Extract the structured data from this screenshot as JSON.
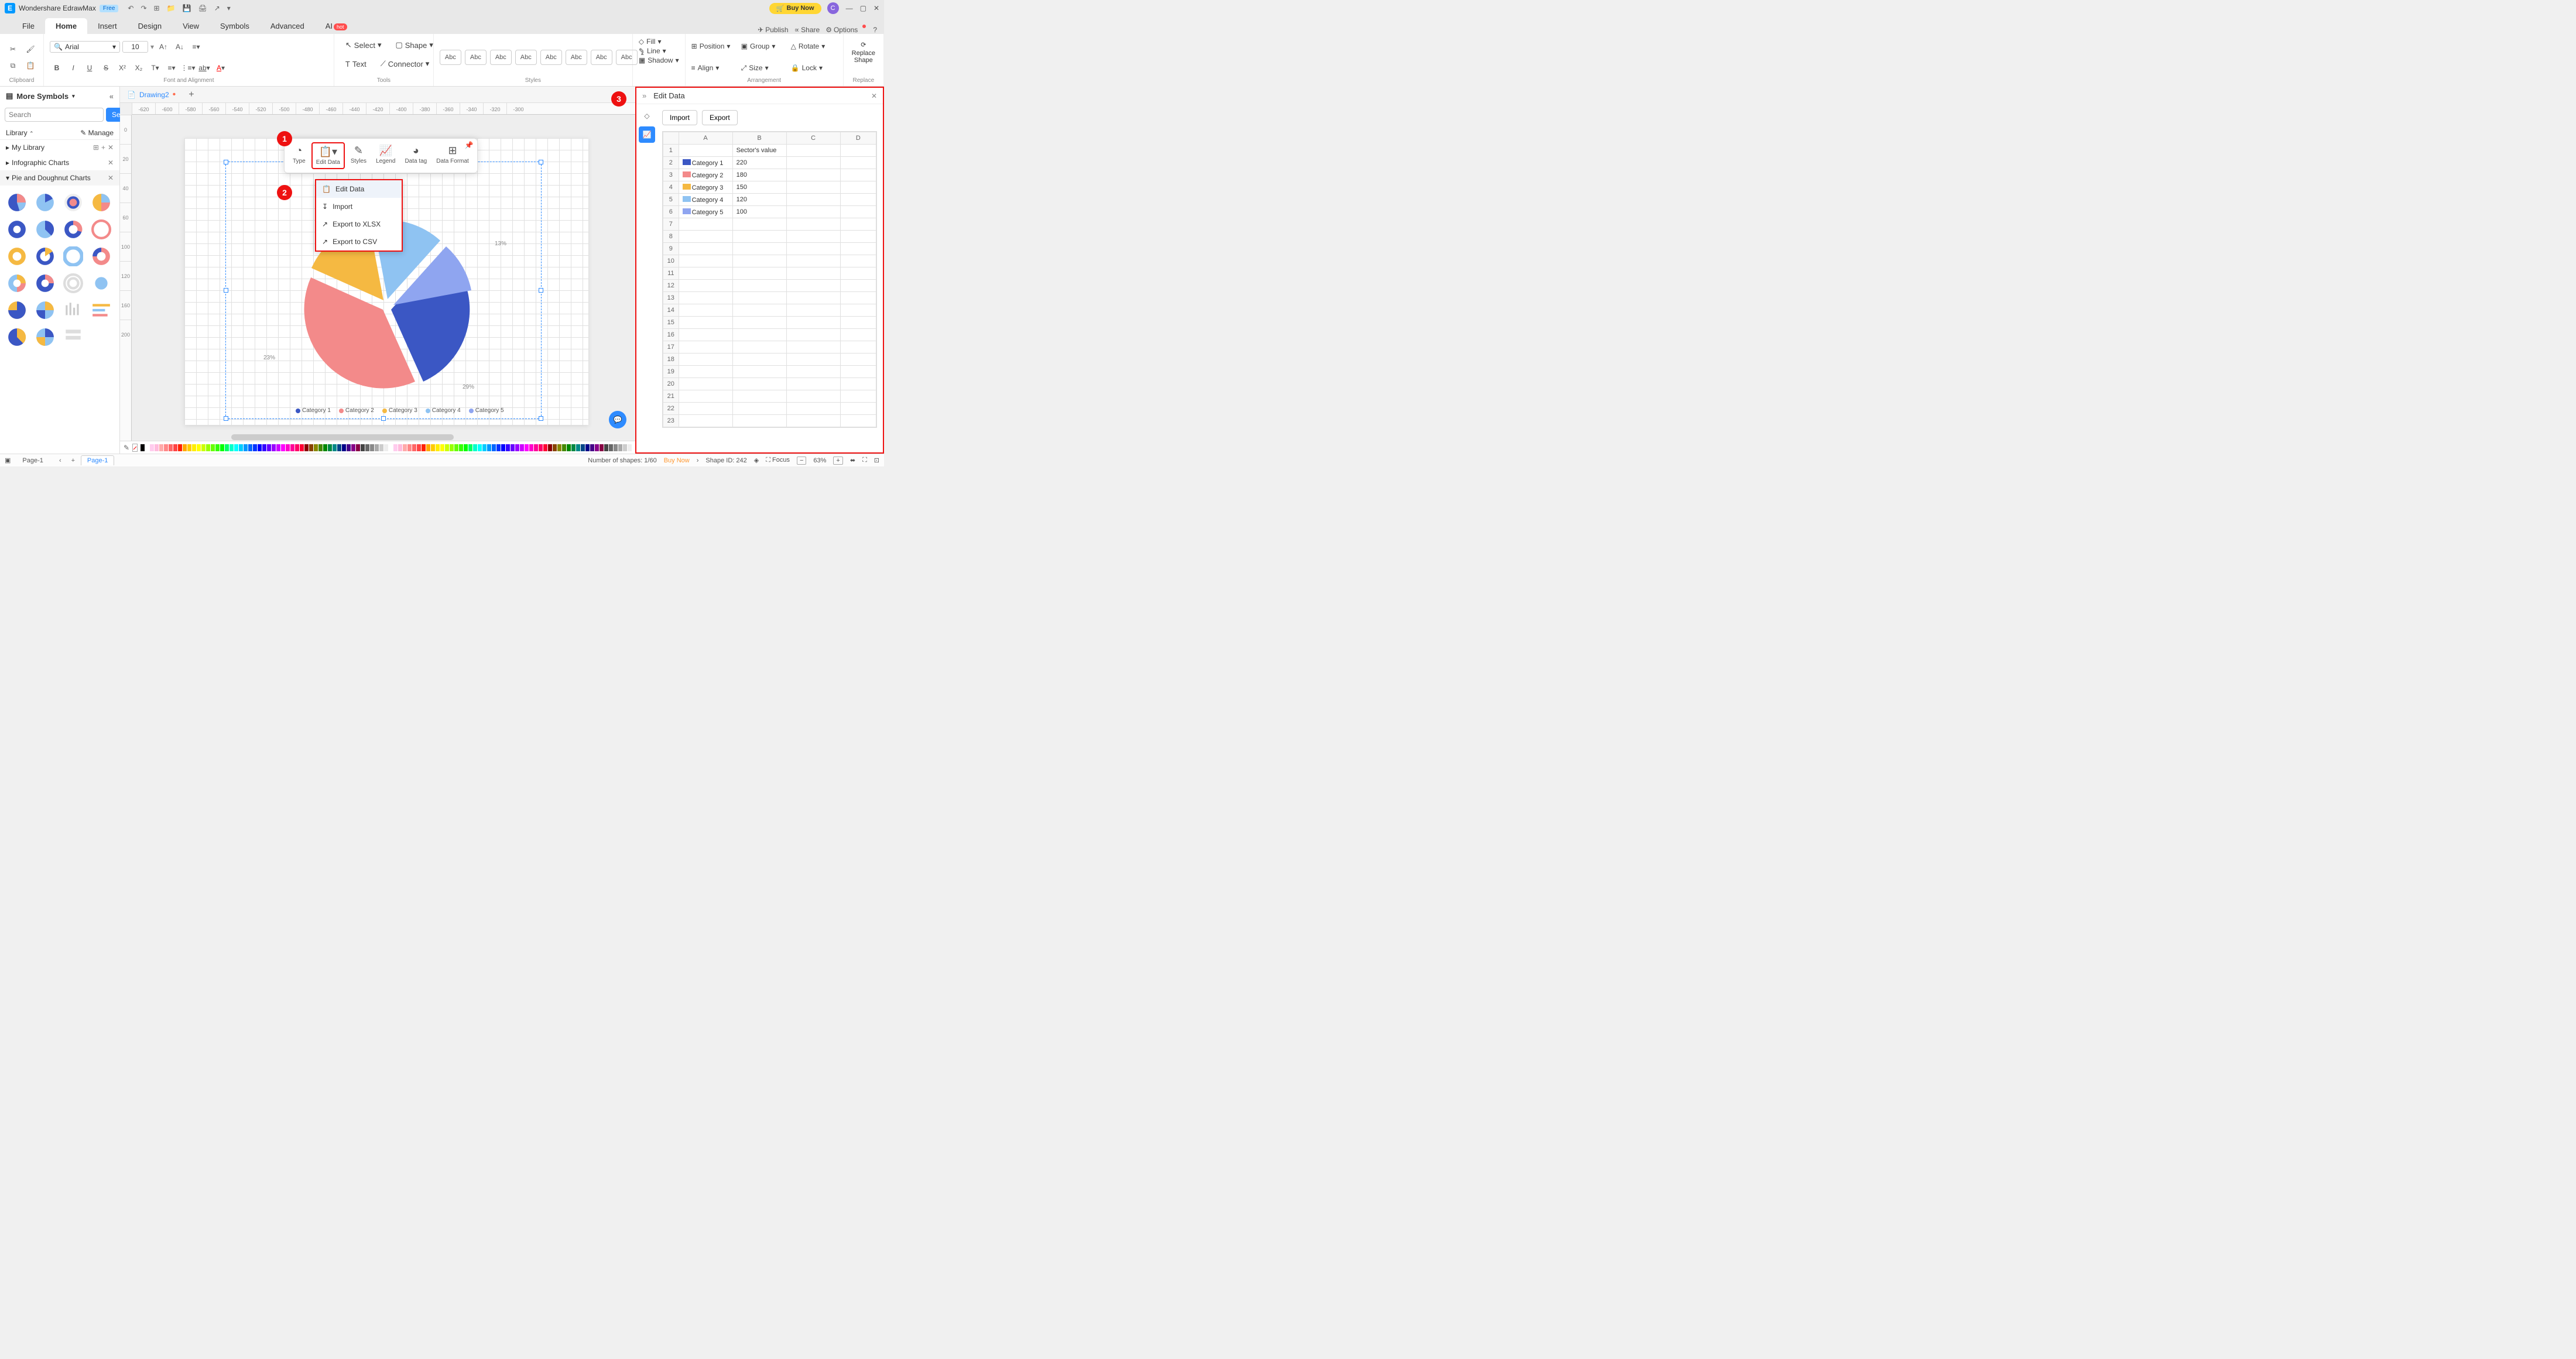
{
  "titlebar": {
    "app_name": "Wondershare EdrawMax",
    "free_badge": "Free",
    "buy_now": "Buy Now",
    "avatar_letter": "C"
  },
  "menubar": {
    "tabs": [
      "File",
      "Home",
      "Insert",
      "Design",
      "View",
      "Symbols",
      "Advanced",
      "AI"
    ],
    "active": "Home",
    "ai_badge": "hot",
    "publish": "Publish",
    "share": "Share",
    "options": "Options"
  },
  "ribbon": {
    "clipboard_label": "Clipboard",
    "font_name": "Arial",
    "font_size": "10",
    "fontalign_label": "Font and Alignment",
    "select": "Select",
    "text": "Text",
    "shape": "Shape",
    "connector": "Connector",
    "tools_label": "Tools",
    "abc": "Abc",
    "styles_label": "Styles",
    "fill": "Fill",
    "line": "Line",
    "shadow": "Shadow",
    "position": "Position",
    "align": "Align",
    "group": "Group",
    "size": "Size",
    "rotate": "Rotate",
    "lock": "Lock",
    "arrangement_label": "Arrangement",
    "replace_shape": "Replace\nShape",
    "replace_label": "Replace"
  },
  "document": {
    "tab_name": "Drawing2"
  },
  "left_panel": {
    "more_symbols": "More Symbols",
    "search_placeholder": "Search",
    "search_btn": "Search",
    "library_label": "Library",
    "manage": "Manage",
    "my_library": "My Library",
    "infographic": "Infographic Charts",
    "pie_doughnut": "Pie and Doughnut Charts"
  },
  "ruler_h": [
    "-620",
    "-600",
    "-580",
    "-560",
    "-540",
    "-520",
    "-500",
    "-480",
    "-460",
    "-440",
    "-420",
    "-400",
    "-380",
    "-360",
    "-340",
    "-320",
    "-300"
  ],
  "ruler_v": [
    "0",
    "20",
    "40",
    "60",
    "100",
    "120",
    "160",
    "200"
  ],
  "float_toolbar": {
    "type": "Type",
    "edit_data": "Edit Data",
    "styles": "Styles",
    "legend": "Legend",
    "data_tag": "Data tag",
    "data_format": "Data Format"
  },
  "dropdown": {
    "edit_data": "Edit Data",
    "import": "Import",
    "export_xlsx": "Export to XLSX",
    "export_csv": "Export to CSV"
  },
  "callouts": {
    "c1": "1",
    "c2": "2",
    "c3": "3"
  },
  "chart_legend": [
    "Category 1",
    "Category 2",
    "Category 3",
    "Category 4",
    "Category 5"
  ],
  "chart_labels": {
    "l1": "13%",
    "l2": "29%",
    "l3": "23%"
  },
  "right_panel": {
    "title": "Edit Data",
    "import": "Import",
    "export": "Export",
    "col_headers": [
      "A",
      "B",
      "C",
      "D"
    ],
    "header_row": "Sector's value",
    "rows": [
      {
        "n": "1",
        "a": "",
        "b": "Sector's value",
        "c": "",
        "color": ""
      },
      {
        "n": "2",
        "a": "Category 1",
        "b": "220",
        "color": "#3b57c4"
      },
      {
        "n": "3",
        "a": "Category 2",
        "b": "180",
        "color": "#f38a8a"
      },
      {
        "n": "4",
        "a": "Category 3",
        "b": "150",
        "color": "#f5b942"
      },
      {
        "n": "5",
        "a": "Category 4",
        "b": "120",
        "color": "#8fc3f2"
      },
      {
        "n": "6",
        "a": "Category 5",
        "b": "100",
        "color": "#8fa5f0"
      }
    ],
    "empty_rows": [
      "7",
      "8",
      "9",
      "10",
      "11",
      "12",
      "13",
      "14",
      "15",
      "16",
      "17",
      "18",
      "19",
      "20",
      "21",
      "22",
      "23"
    ]
  },
  "chart_data": {
    "type": "pie",
    "title": "",
    "series": [
      {
        "name": "Category 1",
        "value": 220,
        "pct": 29,
        "color": "#3b57c4"
      },
      {
        "name": "Category 2",
        "value": 180,
        "pct": 23,
        "color": "#f38a8a"
      },
      {
        "name": "Category 3",
        "value": 150,
        "pct": 19,
        "color": "#f5b942"
      },
      {
        "name": "Category 4",
        "value": 120,
        "pct": 16,
        "color": "#8fc3f2"
      },
      {
        "name": "Category 5",
        "value": 100,
        "pct": 13,
        "color": "#8fa5f0"
      }
    ]
  },
  "statusbar": {
    "page_label": "Page-1",
    "page_tab": "Page-1",
    "shapes_info": "Number of shapes: 1/60",
    "buy_now": "Buy Now",
    "shape_id": "Shape ID: 242",
    "focus": "Focus",
    "zoom": "63%"
  },
  "colors": {
    "cat1": "#3b57c4",
    "cat2": "#f38a8a",
    "cat3": "#f5b942",
    "cat4": "#8fc3f2",
    "cat5": "#8fa5f0"
  }
}
